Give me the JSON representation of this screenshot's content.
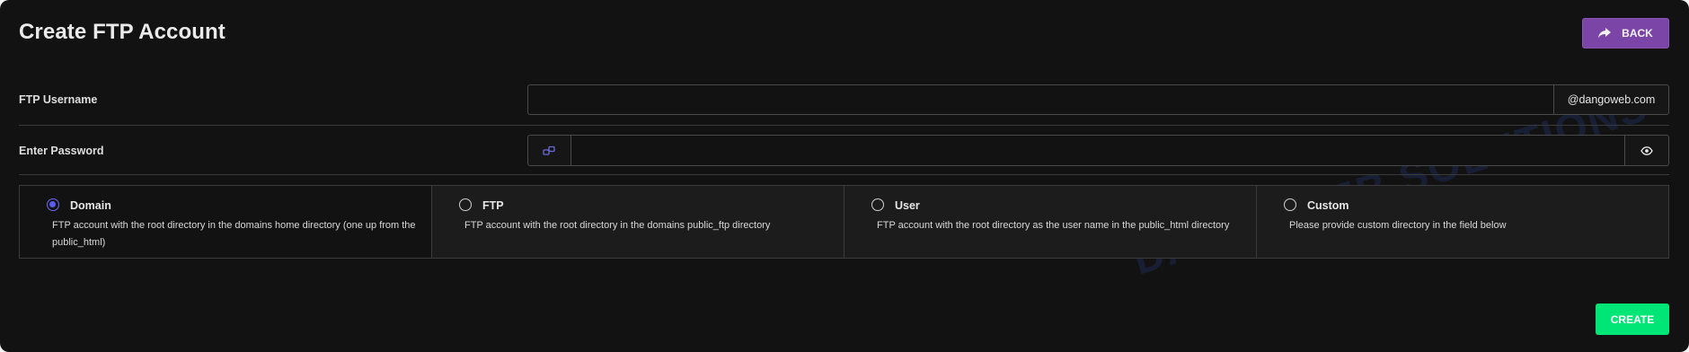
{
  "header": {
    "title": "Create FTP Account",
    "back_label": "BACK",
    "back_icon": "share-forward-icon"
  },
  "form": {
    "username": {
      "label": "FTP Username",
      "value": "",
      "placeholder": "",
      "suffix": "@dangoweb.com"
    },
    "password": {
      "label": "Enter Password",
      "value": "",
      "placeholder": "",
      "generate_icon": "key-generator-icon",
      "toggle_icon": "eye-icon"
    }
  },
  "directory_options": [
    {
      "label": "Domain",
      "description": "FTP account with the root directory in the domains home directory (one up from the public_html)",
      "selected": true
    },
    {
      "label": "FTP",
      "description": "FTP account with the root directory in the domains public_ftp directory",
      "selected": false
    },
    {
      "label": "User",
      "description": "FTP account with the root directory as the user name in the public_html directory",
      "selected": false
    },
    {
      "label": "Custom",
      "description": "Please provide custom directory in the field below",
      "selected": false
    }
  ],
  "actions": {
    "create_label": "CREATE"
  },
  "watermark": "DANGOWEB SOLUTIONS",
  "colors": {
    "background": "#121212",
    "back_button": "#7a45a6",
    "create_button": "#00e676",
    "radio_selected": "#5a5af0"
  }
}
